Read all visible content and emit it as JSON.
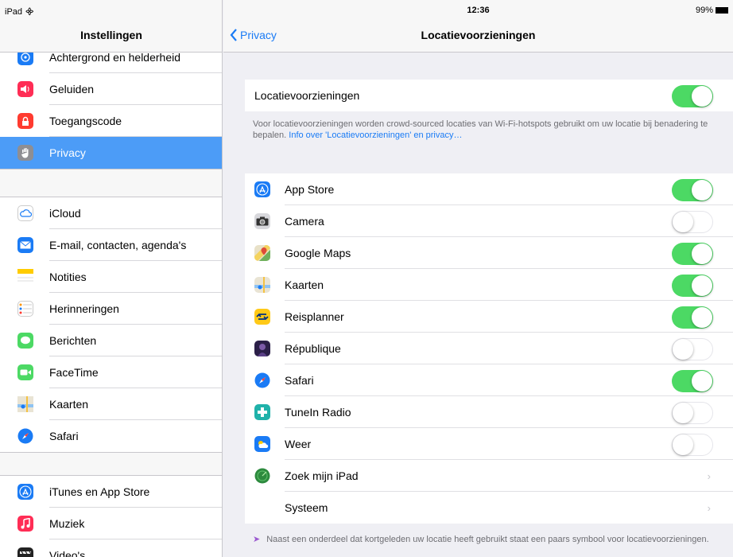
{
  "status": {
    "device": "iPad",
    "time": "12:36",
    "battery": "99%"
  },
  "sidebar": {
    "title": "Instellingen",
    "group1": [
      {
        "label": "Achtergrond en helderheid",
        "icon": "wallpaper-icon",
        "color": "#1a7bf5"
      },
      {
        "label": "Geluiden",
        "icon": "sound-icon",
        "color": "#ff2d55"
      },
      {
        "label": "Toegangscode",
        "icon": "lock-icon",
        "color": "#ff3b30"
      },
      {
        "label": "Privacy",
        "icon": "hand-icon",
        "color": "#8e8e93",
        "selected": true
      }
    ],
    "group2": [
      {
        "label": "iCloud",
        "icon": "cloud-icon",
        "color": "#ffffff"
      },
      {
        "label": "E-mail, contacten, agenda's",
        "icon": "mail-icon",
        "color": "#1a7bf5"
      },
      {
        "label": "Notities",
        "icon": "notes-icon",
        "color": "#ffcc00"
      },
      {
        "label": "Herinneringen",
        "icon": "reminders-icon",
        "color": "#ffffff"
      },
      {
        "label": "Berichten",
        "icon": "messages-icon",
        "color": "#4cd964"
      },
      {
        "label": "FaceTime",
        "icon": "facetime-icon",
        "color": "#4cd964"
      },
      {
        "label": "Kaarten",
        "icon": "maps-icon",
        "color": "#8fc3f2"
      },
      {
        "label": "Safari",
        "icon": "safari-icon",
        "color": "#1a7bf5"
      }
    ],
    "group3": [
      {
        "label": "iTunes en App Store",
        "icon": "appstore-icon",
        "color": "#1a7bf5"
      },
      {
        "label": "Muziek",
        "icon": "music-icon",
        "color": "#ff2d55"
      },
      {
        "label": "Video's",
        "icon": "video-icon",
        "color": "#222222"
      }
    ]
  },
  "main": {
    "back_label": "Privacy",
    "title": "Locatievoorzieningen",
    "master": {
      "label": "Locatievoorzieningen",
      "on": true
    },
    "footnote_text": "Voor locatievoorzieningen worden crowd-sourced locaties van Wi-Fi-hotspots gebruikt om uw locatie bij benadering te bepalen.",
    "footnote_link": "Info over 'Locatievoorzieningen' en privacy…",
    "apps": [
      {
        "label": "App Store",
        "icon": "appstore-icon",
        "color": "#1a7bf5",
        "on": true
      },
      {
        "label": "Camera",
        "icon": "camera-icon",
        "color": "#8e8e93",
        "on": false
      },
      {
        "label": "Google Maps",
        "icon": "googlemaps-icon",
        "color": "#5bb85d",
        "on": true
      },
      {
        "label": "Kaarten",
        "icon": "maps-icon",
        "color": "#8fc3f2",
        "on": true
      },
      {
        "label": "Reisplanner",
        "icon": "ns-icon",
        "color": "#ffc917",
        "on": true
      },
      {
        "label": "République",
        "icon": "republique-icon",
        "color": "#3a2a5e",
        "on": false
      },
      {
        "label": "Safari",
        "icon": "safari-icon",
        "color": "#1a7bf5",
        "on": true
      },
      {
        "label": "TuneIn Radio",
        "icon": "tunein-icon",
        "color": "#20b2aa",
        "on": false
      },
      {
        "label": "Weer",
        "icon": "weather-icon",
        "color": "#1a7bf5",
        "on": false
      }
    ],
    "links": [
      {
        "label": "Zoek mijn iPad",
        "icon": "findmy-icon",
        "color": "#2d8a3e"
      },
      {
        "label": "Systeem"
      }
    ],
    "footnote2": "Naast een onderdeel dat kortgeleden uw locatie heeft gebruikt staat een paars symbool voor locatievoorzieningen."
  }
}
